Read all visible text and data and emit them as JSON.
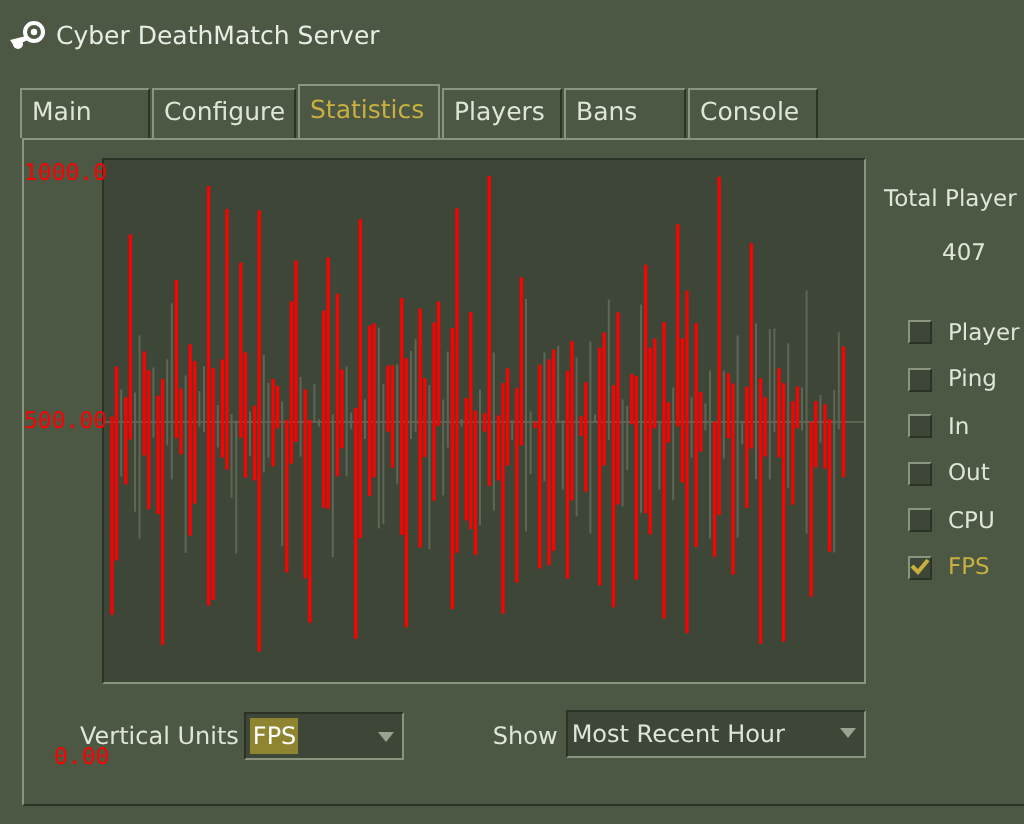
{
  "window": {
    "title": "Cyber DeathMatch Server"
  },
  "tabs": [
    {
      "label": "Main",
      "selected": false
    },
    {
      "label": "Configure",
      "selected": false
    },
    {
      "label": "Statistics",
      "selected": true
    },
    {
      "label": "Players",
      "selected": false
    },
    {
      "label": "Bans",
      "selected": false
    },
    {
      "label": "Console",
      "selected": false
    }
  ],
  "graph": {
    "axis_labels": [
      "1000.0",
      "500.00",
      "0.00"
    ]
  },
  "summary": {
    "label": "Total Player",
    "value": "407"
  },
  "series_toggles": [
    {
      "label": "Player",
      "checked": false
    },
    {
      "label": "Ping",
      "checked": false
    },
    {
      "label": "In",
      "checked": false
    },
    {
      "label": "Out",
      "checked": false
    },
    {
      "label": "CPU",
      "checked": false
    },
    {
      "label": "FPS",
      "checked": true
    }
  ],
  "vertical_units": {
    "label": "Vertical Units",
    "value": "FPS"
  },
  "show": {
    "label": "Show",
    "value": "Most Recent Hour"
  }
}
